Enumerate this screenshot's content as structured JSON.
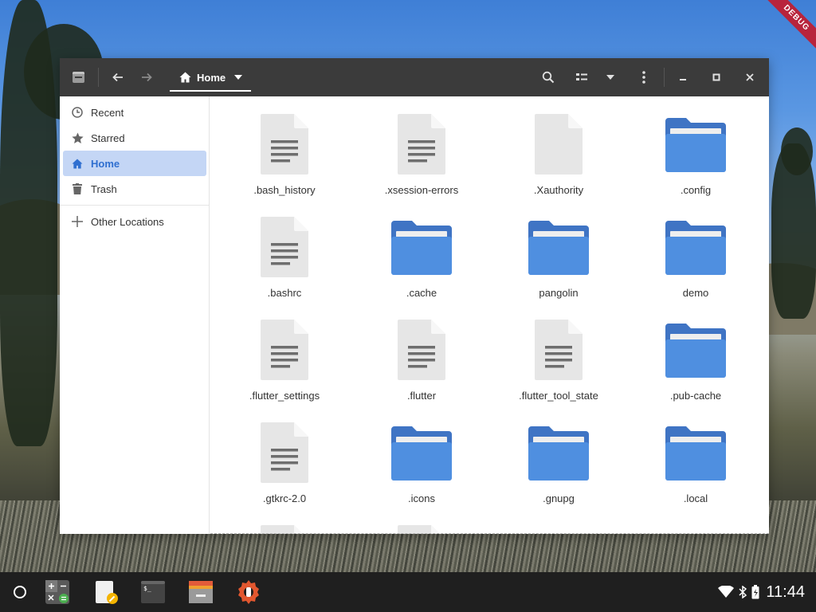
{
  "debug_banner": "DEBUG",
  "window": {
    "path": "Home",
    "sidebar": {
      "items": [
        {
          "label": "Recent",
          "icon": "clock-icon"
        },
        {
          "label": "Starred",
          "icon": "star-icon"
        },
        {
          "label": "Home",
          "icon": "home-icon",
          "active": true
        },
        {
          "label": "Trash",
          "icon": "trash-icon"
        }
      ],
      "other_locations": "Other Locations"
    },
    "files": [
      {
        "name": ".bash_history",
        "type": "document"
      },
      {
        "name": ".xsession-errors",
        "type": "document"
      },
      {
        "name": ".Xauthority",
        "type": "blank-document"
      },
      {
        "name": ".config",
        "type": "folder"
      },
      {
        "name": ".bashrc",
        "type": "document"
      },
      {
        "name": ".cache",
        "type": "folder"
      },
      {
        "name": "pangolin",
        "type": "folder"
      },
      {
        "name": "demo",
        "type": "folder"
      },
      {
        "name": ".flutter_settings",
        "type": "document"
      },
      {
        "name": ".flutter",
        "type": "document"
      },
      {
        "name": ".flutter_tool_state",
        "type": "document"
      },
      {
        "name": ".pub-cache",
        "type": "folder"
      },
      {
        "name": ".gtkrc-2.0",
        "type": "document"
      },
      {
        "name": ".icons",
        "type": "folder"
      },
      {
        "name": ".gnupg",
        "type": "folder"
      },
      {
        "name": ".local",
        "type": "folder"
      }
    ]
  },
  "colors": {
    "titlebar": "#3b3b3b",
    "folder": "#4f8fe0",
    "folder_back": "#3f74c4",
    "doc": "#e6e6e6",
    "active_bg": "#c4d6f5",
    "accent": "#2f6fd0"
  },
  "taskbar": {
    "apps": [
      "calculator-icon",
      "text-editor-icon",
      "terminal-icon",
      "file-manager-icon",
      "settings-icon"
    ],
    "time": "11:44"
  }
}
